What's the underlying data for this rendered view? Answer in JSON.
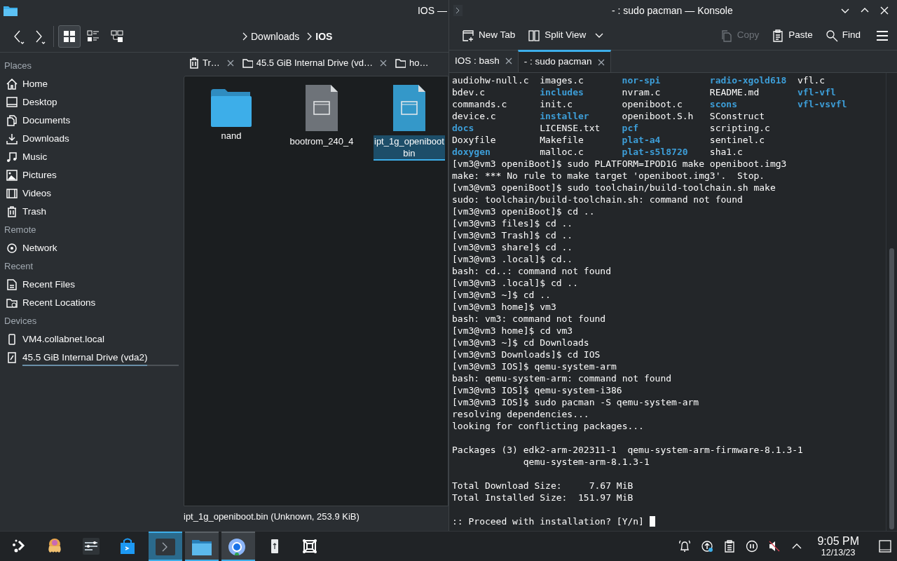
{
  "file_manager": {
    "title": "IOS —",
    "view_modes": [
      {
        "kind": "icons",
        "selected": true
      },
      {
        "kind": "details",
        "selected": false
      },
      {
        "kind": "tree",
        "selected": false
      }
    ],
    "breadcrumb": [
      {
        "label": "Downloads",
        "current": false
      },
      {
        "label": "IOS",
        "current": true
      }
    ],
    "sidebar": [
      {
        "heading": "Places",
        "items": [
          {
            "label": "Home",
            "kind": "home"
          },
          {
            "label": "Desktop",
            "kind": "desktop"
          },
          {
            "label": "Documents",
            "kind": "documents"
          },
          {
            "label": "Downloads",
            "kind": "downloads"
          },
          {
            "label": "Music",
            "kind": "music"
          },
          {
            "label": "Pictures",
            "kind": "pictures"
          },
          {
            "label": "Videos",
            "kind": "videos"
          },
          {
            "label": "Trash",
            "kind": "trash"
          }
        ]
      },
      {
        "heading": "Remote",
        "items": [
          {
            "label": "Network",
            "kind": "network"
          }
        ]
      },
      {
        "heading": "Recent",
        "items": [
          {
            "label": "Recent Files",
            "kind": "recent"
          },
          {
            "label": "Recent Locations",
            "kind": "recent-folder"
          }
        ]
      },
      {
        "heading": "Devices",
        "items": [
          {
            "label": "VM4.collabnet.local",
            "kind": "device"
          },
          {
            "label": "45.5 GiB Internal Drive (vda2)",
            "kind": "drive",
            "level": 0.8
          }
        ]
      }
    ],
    "tabs": [
      {
        "label": "Tr…",
        "kind": "trash"
      },
      {
        "label": "45.5 GiB Internal Drive (vd…",
        "kind": "folder"
      },
      {
        "label": "ho…",
        "kind": "folder"
      }
    ],
    "files": [
      {
        "name": "nand",
        "kind": "folder",
        "selected": false
      },
      {
        "name": "bootrom_240_4",
        "kind": "unknown",
        "selected": false
      },
      {
        "name": "ipt_1g_openiboot",
        "name_line_2": "bin",
        "kind": "unknown",
        "selected": true
      }
    ],
    "status": "ipt_1g_openiboot.bin (Unknown, 253.9 KiB)"
  },
  "konsole": {
    "title": "- : sudo pacman — Konsole",
    "toolbar": [
      {
        "label": "New Tab",
        "kind": "new-tab",
        "disabled": false
      },
      {
        "label": "Split View",
        "kind": "split",
        "disabled": false
      },
      {
        "label": "Copy",
        "kind": "copy",
        "disabled": true
      },
      {
        "label": "Paste",
        "kind": "paste",
        "disabled": false
      },
      {
        "label": "Find",
        "kind": "find",
        "disabled": false
      }
    ],
    "tabs": [
      {
        "label": "IOS : bash",
        "selected": false
      },
      {
        "label": "- : sudo pacman",
        "selected": true
      }
    ],
    "listing": [
      [
        {
          "name": "audiohw-null.c",
          "kind": "file"
        },
        {
          "name": "images.c",
          "kind": "file"
        },
        {
          "name": "nor-spi",
          "kind": "dir"
        },
        {
          "name": "radio-xgold618",
          "kind": "dir"
        },
        {
          "name": "vfl.c",
          "kind": "file"
        }
      ],
      [
        {
          "name": "bdev.c",
          "kind": "file"
        },
        {
          "name": "includes",
          "kind": "dir"
        },
        {
          "name": "nvram.c",
          "kind": "file"
        },
        {
          "name": "README.md",
          "kind": "file"
        },
        {
          "name": "vfl-vfl",
          "kind": "dir"
        }
      ],
      [
        {
          "name": "commands.c",
          "kind": "file"
        },
        {
          "name": "init.c",
          "kind": "file"
        },
        {
          "name": "openiboot.c",
          "kind": "file"
        },
        {
          "name": "scons",
          "kind": "dir"
        },
        {
          "name": "vfl-vsvfl",
          "kind": "dir"
        }
      ],
      [
        {
          "name": "device.c",
          "kind": "file"
        },
        {
          "name": "installer",
          "kind": "dir"
        },
        {
          "name": "openiboot.S.h",
          "kind": "file"
        },
        {
          "name": "SConstruct",
          "kind": "file"
        }
      ],
      [
        {
          "name": "docs",
          "kind": "dir"
        },
        {
          "name": "LICENSE.txt",
          "kind": "file"
        },
        {
          "name": "pcf",
          "kind": "dir"
        },
        {
          "name": "scripting.c",
          "kind": "file"
        }
      ],
      [
        {
          "name": "Doxyfile",
          "kind": "file"
        },
        {
          "name": "Makefile",
          "kind": "file"
        },
        {
          "name": "plat-a4",
          "kind": "dir"
        },
        {
          "name": "sentinel.c",
          "kind": "file"
        }
      ],
      [
        {
          "name": "doxygen",
          "kind": "dir"
        },
        {
          "name": "malloc.c",
          "kind": "file"
        },
        {
          "name": "plat-s5l8720",
          "kind": "dir"
        },
        {
          "name": "sha1.c",
          "kind": "file"
        }
      ]
    ],
    "lines": [
      {
        "kind": "text",
        "text": "[vm3@vm3 openiBoot]$ sudo PLATFORM=IPOD1G make openiboot.img3"
      },
      {
        "kind": "text",
        "text": "make: *** No rule to make target 'openiboot.img3'.  Stop."
      },
      {
        "kind": "text",
        "text": "[vm3@vm3 openiBoot]$ sudo toolchain/build-toolchain.sh make"
      },
      {
        "kind": "text",
        "text": "sudo: toolchain/build-toolchain.sh: command not found"
      },
      {
        "kind": "text",
        "text": "[vm3@vm3 openiBoot]$ cd .."
      },
      {
        "kind": "text",
        "text": "[vm3@vm3 files]$ cd .."
      },
      {
        "kind": "text",
        "text": "[vm3@vm3 Trash]$ cd .."
      },
      {
        "kind": "text",
        "text": "[vm3@vm3 share]$ cd .."
      },
      {
        "kind": "text",
        "text": "[vm3@vm3 .local]$ cd.."
      },
      {
        "kind": "text",
        "text": "bash: cd..: command not found"
      },
      {
        "kind": "text",
        "text": "[vm3@vm3 .local]$ cd .."
      },
      {
        "kind": "text",
        "text": "[vm3@vm3 ~]$ cd .."
      },
      {
        "kind": "text",
        "text": "[vm3@vm3 home]$ vm3"
      },
      {
        "kind": "text",
        "text": "bash: vm3: command not found"
      },
      {
        "kind": "text",
        "text": "[vm3@vm3 home]$ cd vm3"
      },
      {
        "kind": "text",
        "text": "[vm3@vm3 ~]$ cd Downloads"
      },
      {
        "kind": "text",
        "text": "[vm3@vm3 Downloads]$ cd IOS"
      },
      {
        "kind": "text",
        "text": "[vm3@vm3 IOS]$ qemu-system-arm"
      },
      {
        "kind": "text",
        "text": "bash: qemu-system-arm: command not found"
      },
      {
        "kind": "text",
        "text": "[vm3@vm3 IOS]$ qemu-system-i386"
      },
      {
        "kind": "text",
        "text": "[vm3@vm3 IOS]$ sudo pacman -S qemu-system-arm"
      },
      {
        "kind": "text",
        "text": "resolving dependencies..."
      },
      {
        "kind": "text",
        "text": "looking for conflicting packages..."
      },
      {
        "kind": "blank"
      },
      {
        "kind": "text",
        "text": "Packages (3) edk2-arm-202311-1  qemu-system-arm-firmware-8.1.3-1"
      },
      {
        "kind": "text",
        "text": "             qemu-system-arm-8.1.3-1"
      },
      {
        "kind": "blank"
      },
      {
        "kind": "text",
        "text": "Total Download Size:     7.67 MiB"
      },
      {
        "kind": "text",
        "text": "Total Installed Size:  151.97 MiB"
      },
      {
        "kind": "blank"
      },
      {
        "kind": "prompt",
        "text": ":: Proceed with installation? [Y/n] "
      }
    ]
  },
  "taskbar": {
    "items": [
      {
        "kind": "launcher",
        "active": false,
        "running": false
      },
      {
        "kind": "octopus",
        "active": false,
        "running": false
      },
      {
        "kind": "settings",
        "active": false,
        "running": false
      },
      {
        "kind": "store",
        "active": false,
        "running": false
      },
      {
        "kind": "terminal",
        "active": true,
        "running": true
      },
      {
        "kind": "files",
        "active": false,
        "running": true
      },
      {
        "kind": "browser",
        "active": false,
        "running": true
      },
      {
        "kind": "usb",
        "active": false,
        "running": false
      },
      {
        "kind": "frame",
        "active": false,
        "running": false
      }
    ],
    "tray": [
      {
        "kind": "bell"
      },
      {
        "kind": "update"
      },
      {
        "kind": "clipboard"
      },
      {
        "kind": "pause"
      },
      {
        "kind": "muted"
      },
      {
        "kind": "chevron"
      }
    ],
    "time": "9:05 PM",
    "date": "12/13/23"
  }
}
